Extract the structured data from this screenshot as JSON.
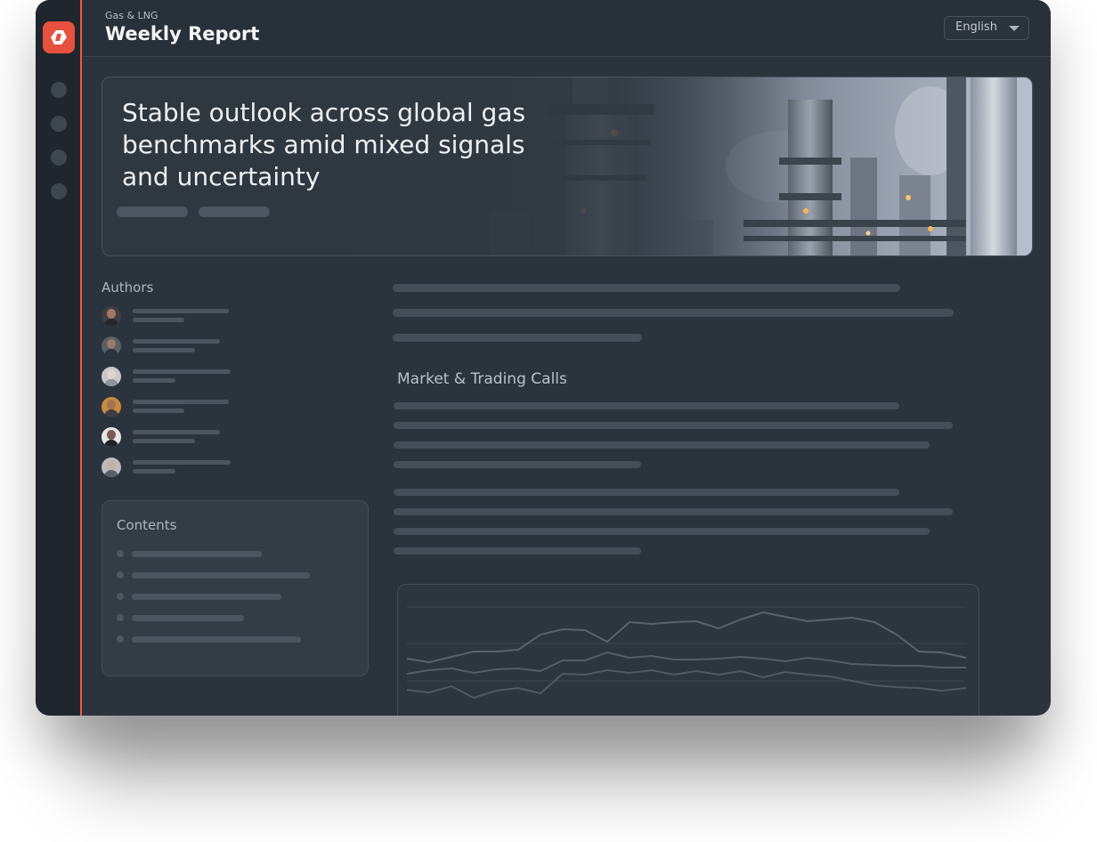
{
  "header": {
    "kicker": "Gas & LNG",
    "title": "Weekly Report",
    "language": {
      "selected": "English"
    }
  },
  "hero": {
    "headline": "Stable outlook across global gas\nbenchmarks amid mixed signals\nand  uncertainty"
  },
  "authors": {
    "title": "Authors",
    "count": 6
  },
  "contents": {
    "title": "Contents",
    "count": 5
  },
  "main": {
    "section_heading": "Market & Trading Calls"
  },
  "icons": {
    "logo": "brand-logo-icon",
    "nav": [
      "nav-dot-icon",
      "nav-dot-icon",
      "nav-dot-icon",
      "nav-dot-icon"
    ],
    "language_caret": "caret-down-icon"
  },
  "colors": {
    "accent": "#e8503f",
    "background": "#2b333c",
    "sidebar": "#1f262e"
  }
}
